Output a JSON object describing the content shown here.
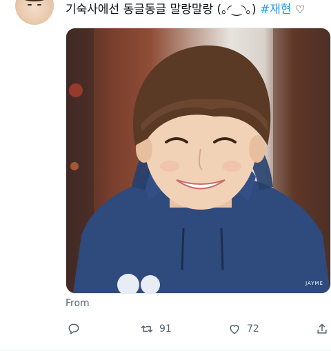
{
  "tweet": {
    "text": "기숙사에선 동글동글 말랑말랑 (｡◜‿◝｡)",
    "hashtag": "#재현",
    "trailing_emoji": "♡"
  },
  "media": {
    "watermark": "JAYME"
  },
  "source_label": "From",
  "actions": {
    "reply": {
      "icon": "reply-icon",
      "count": ""
    },
    "retweet": {
      "icon": "retweet-icon",
      "count": "91"
    },
    "like": {
      "icon": "heart-icon",
      "count": "72"
    },
    "share": {
      "icon": "share-icon",
      "count": ""
    }
  },
  "colors": {
    "accent": "#1d9bf0",
    "muted": "#536471",
    "text": "#0f1419"
  }
}
